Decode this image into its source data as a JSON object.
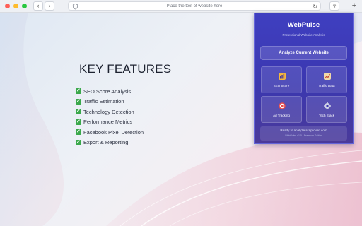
{
  "browser": {
    "url_placeholder": "Place the text of website here",
    "back_icon": "‹",
    "forward_icon": "›",
    "reload_icon": "↻",
    "share_icon": "⇪",
    "newtab_icon": "+"
  },
  "page": {
    "heading": "KEY FEATURES",
    "features": [
      "SEO Score Analysis",
      "Traffic Estimation",
      "Technology Detection",
      "Performance Metrics",
      "Facebook Pixel Detection",
      "Export & Reporting"
    ],
    "check_glyph": "✓"
  },
  "popup": {
    "title": "WebPulse",
    "subtitle": "Professional Website Analysis",
    "analyze_label": "Analyze Current Website",
    "tiles": [
      {
        "label": "SEO Score",
        "icon": "bar-chart-icon",
        "color": "#f4b63e"
      },
      {
        "label": "Traffic Data",
        "icon": "trend-chart-icon",
        "color": "#f0d9a8"
      },
      {
        "label": "Ad Tracking",
        "icon": "target-icon",
        "color": "#e64b4b"
      },
      {
        "label": "Tech Stack",
        "icon": "gear-icon",
        "color": "#cfd2e6"
      }
    ],
    "status_text": "Ready to analyze scriptoven.com",
    "footer_text": "WebPulse v1.0 - Premium Edition"
  },
  "colors": {
    "popup_bg": "#3f3fc0",
    "check_green": "#3aa84b"
  }
}
